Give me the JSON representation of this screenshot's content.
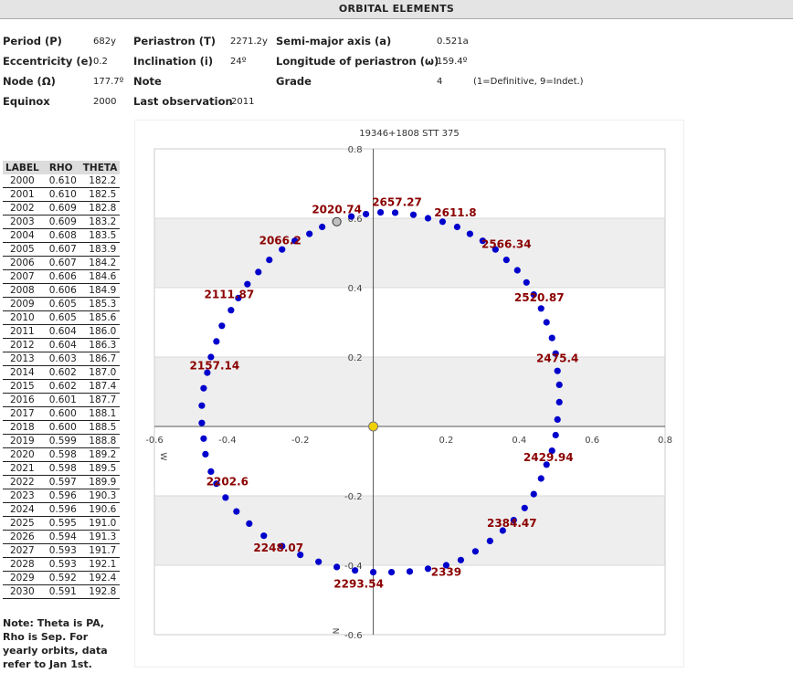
{
  "header": {
    "title": "ORBITAL ELEMENTS"
  },
  "elements": {
    "period_label": "Period (P)",
    "period_value": "682y",
    "periastron_label": "Periastron (T)",
    "periastron_value": "2271.2y",
    "semimajor_label": "Semi-major axis (a)",
    "semimajor_value": "0.521a",
    "ecc_label": "Eccentricity (e)",
    "ecc_value": "0.2",
    "incl_label": "Inclination (i)",
    "incl_value": "24º",
    "lop_label": "Longitude of periastron (ω)",
    "lop_value": "159.4º",
    "node_label": "Node (Ω)",
    "node_value": "177.7º",
    "note_label": "Note",
    "grade_label": "Grade",
    "grade_value": "4",
    "grade_hint": "(1=Definitive, 9=Indet.)",
    "equinox_label": "Equinox",
    "equinox_value": "2000",
    "lastobs_label": "Last observation",
    "lastobs_value": "2011"
  },
  "ephemeris": {
    "columns": [
      "LABEL",
      "RHO",
      "THETA"
    ],
    "rows": [
      [
        "2000",
        "0.610",
        "182.2"
      ],
      [
        "2001",
        "0.610",
        "182.5"
      ],
      [
        "2002",
        "0.609",
        "182.8"
      ],
      [
        "2003",
        "0.609",
        "183.2"
      ],
      [
        "2004",
        "0.608",
        "183.5"
      ],
      [
        "2005",
        "0.607",
        "183.9"
      ],
      [
        "2006",
        "0.607",
        "184.2"
      ],
      [
        "2007",
        "0.606",
        "184.6"
      ],
      [
        "2008",
        "0.606",
        "184.9"
      ],
      [
        "2009",
        "0.605",
        "185.3"
      ],
      [
        "2010",
        "0.605",
        "185.6"
      ],
      [
        "2011",
        "0.604",
        "186.0"
      ],
      [
        "2012",
        "0.604",
        "186.3"
      ],
      [
        "2013",
        "0.603",
        "186.7"
      ],
      [
        "2014",
        "0.602",
        "187.0"
      ],
      [
        "2015",
        "0.602",
        "187.4"
      ],
      [
        "2016",
        "0.601",
        "187.7"
      ],
      [
        "2017",
        "0.600",
        "188.1"
      ],
      [
        "2018",
        "0.600",
        "188.5"
      ],
      [
        "2019",
        "0.599",
        "188.8"
      ],
      [
        "2020",
        "0.598",
        "189.2"
      ],
      [
        "2021",
        "0.598",
        "189.5"
      ],
      [
        "2022",
        "0.597",
        "189.9"
      ],
      [
        "2023",
        "0.596",
        "190.3"
      ],
      [
        "2024",
        "0.596",
        "190.6"
      ],
      [
        "2025",
        "0.595",
        "191.0"
      ],
      [
        "2026",
        "0.594",
        "191.3"
      ],
      [
        "2027",
        "0.593",
        "191.7"
      ],
      [
        "2028",
        "0.593",
        "192.1"
      ],
      [
        "2029",
        "0.592",
        "192.4"
      ],
      [
        "2030",
        "0.591",
        "192.8"
      ]
    ]
  },
  "note": [
    "Note: Theta is PA,",
    "Rho is Sep. For",
    "yearly orbits, data",
    "refer to Jan 1st."
  ],
  "chart_data": {
    "type": "scatter",
    "title": "19346+1808 STT 375",
    "xlim": [
      -0.6,
      0.8
    ],
    "ylim": [
      -0.6,
      0.8
    ],
    "xticks": [
      "-0.6",
      "-0.4",
      "-0.2",
      "0.2",
      "0.4",
      "0.6",
      "0.8"
    ],
    "yticks": [
      "0.8",
      "0.6",
      "0.4",
      "0.2",
      "-0.2",
      "-0.4",
      "-0.6"
    ],
    "xtick_values": [
      -0.6,
      -0.4,
      -0.2,
      0.2,
      0.4,
      0.6,
      0.8
    ],
    "ytick_values": [
      0.8,
      0.6,
      0.4,
      0.2,
      -0.2,
      -0.4,
      -0.6
    ],
    "west_label": "W",
    "north_label": "N",
    "grid": "alternating horizontal bands",
    "colors": {
      "orbit": "#0000cc",
      "label": "#8b0000",
      "primary": "#f0d000",
      "current": "#c0c0c0",
      "band": "#eeeeee"
    },
    "primary": {
      "x": 0,
      "y": 0
    },
    "current_position": {
      "x": -0.1,
      "y": 0.59
    },
    "orbit_points": [
      {
        "x": -0.1,
        "y": 0.59
      },
      {
        "x": -0.06,
        "y": 0.605
      },
      {
        "x": -0.02,
        "y": 0.612
      },
      {
        "x": 0.02,
        "y": 0.617
      },
      {
        "x": 0.06,
        "y": 0.616
      },
      {
        "x": 0.11,
        "y": 0.61
      },
      {
        "x": 0.15,
        "y": 0.6
      },
      {
        "x": 0.19,
        "y": 0.59
      },
      {
        "x": 0.23,
        "y": 0.575
      },
      {
        "x": 0.265,
        "y": 0.555
      },
      {
        "x": 0.3,
        "y": 0.535
      },
      {
        "x": 0.335,
        "y": 0.51
      },
      {
        "x": 0.365,
        "y": 0.48
      },
      {
        "x": 0.395,
        "y": 0.45
      },
      {
        "x": 0.42,
        "y": 0.415
      },
      {
        "x": 0.44,
        "y": 0.38
      },
      {
        "x": 0.46,
        "y": 0.34
      },
      {
        "x": 0.475,
        "y": 0.3
      },
      {
        "x": 0.49,
        "y": 0.255
      },
      {
        "x": 0.5,
        "y": 0.21
      },
      {
        "x": 0.505,
        "y": 0.16
      },
      {
        "x": 0.51,
        "y": 0.12
      },
      {
        "x": 0.51,
        "y": 0.07
      },
      {
        "x": 0.505,
        "y": 0.02
      },
      {
        "x": 0.5,
        "y": -0.025
      },
      {
        "x": 0.49,
        "y": -0.07
      },
      {
        "x": 0.475,
        "y": -0.11
      },
      {
        "x": 0.46,
        "y": -0.15
      },
      {
        "x": 0.44,
        "y": -0.195
      },
      {
        "x": 0.415,
        "y": -0.235
      },
      {
        "x": 0.385,
        "y": -0.27
      },
      {
        "x": 0.355,
        "y": -0.3
      },
      {
        "x": 0.32,
        "y": -0.33
      },
      {
        "x": 0.28,
        "y": -0.36
      },
      {
        "x": 0.24,
        "y": -0.385
      },
      {
        "x": 0.2,
        "y": -0.4
      },
      {
        "x": 0.15,
        "y": -0.41
      },
      {
        "x": 0.1,
        "y": -0.418
      },
      {
        "x": 0.05,
        "y": -0.42
      },
      {
        "x": 0.0,
        "y": -0.42
      },
      {
        "x": -0.05,
        "y": -0.415
      },
      {
        "x": -0.1,
        "y": -0.405
      },
      {
        "x": -0.15,
        "y": -0.39
      },
      {
        "x": -0.2,
        "y": -0.37
      },
      {
        "x": -0.25,
        "y": -0.345
      },
      {
        "x": -0.3,
        "y": -0.315
      },
      {
        "x": -0.34,
        "y": -0.28
      },
      {
        "x": -0.375,
        "y": -0.245
      },
      {
        "x": -0.405,
        "y": -0.205
      },
      {
        "x": -0.43,
        "y": -0.165
      },
      {
        "x": -0.445,
        "y": -0.13
      },
      {
        "x": -0.46,
        "y": -0.08
      },
      {
        "x": -0.465,
        "y": -0.035
      },
      {
        "x": -0.47,
        "y": 0.01
      },
      {
        "x": -0.47,
        "y": 0.06
      },
      {
        "x": -0.465,
        "y": 0.11
      },
      {
        "x": -0.455,
        "y": 0.155
      },
      {
        "x": -0.445,
        "y": 0.2
      },
      {
        "x": -0.43,
        "y": 0.245
      },
      {
        "x": -0.415,
        "y": 0.29
      },
      {
        "x": -0.39,
        "y": 0.335
      },
      {
        "x": -0.37,
        "y": 0.37
      },
      {
        "x": -0.345,
        "y": 0.41
      },
      {
        "x": -0.315,
        "y": 0.445
      },
      {
        "x": -0.285,
        "y": 0.48
      },
      {
        "x": -0.25,
        "y": 0.51
      },
      {
        "x": -0.215,
        "y": 0.535
      },
      {
        "x": -0.175,
        "y": 0.555
      },
      {
        "x": -0.14,
        "y": 0.575
      }
    ],
    "epoch_labels": [
      {
        "text": "2657.27",
        "x": 0.065,
        "y": 0.635
      },
      {
        "text": "2611.8",
        "x": 0.225,
        "y": 0.605
      },
      {
        "text": "2566.34",
        "x": 0.365,
        "y": 0.515
      },
      {
        "text": "2520.87",
        "x": 0.455,
        "y": 0.36
      },
      {
        "text": "2475.4",
        "x": 0.505,
        "y": 0.185
      },
      {
        "text": "2429.94",
        "x": 0.48,
        "y": -0.1
      },
      {
        "text": "2384.47",
        "x": 0.38,
        "y": -0.29
      },
      {
        "text": "2339",
        "x": 0.2,
        "y": -0.43
      },
      {
        "text": "2293.54",
        "x": -0.04,
        "y": -0.465
      },
      {
        "text": "2248.07",
        "x": -0.26,
        "y": -0.36
      },
      {
        "text": "2202.6",
        "x": -0.4,
        "y": -0.17
      },
      {
        "text": "2157.14",
        "x": -0.435,
        "y": 0.165
      },
      {
        "text": "2111.87",
        "x": -0.395,
        "y": 0.37
      },
      {
        "text": "2066.2",
        "x": -0.255,
        "y": 0.525
      },
      {
        "text": "2020.74",
        "x": -0.1,
        "y": 0.615
      }
    ]
  }
}
